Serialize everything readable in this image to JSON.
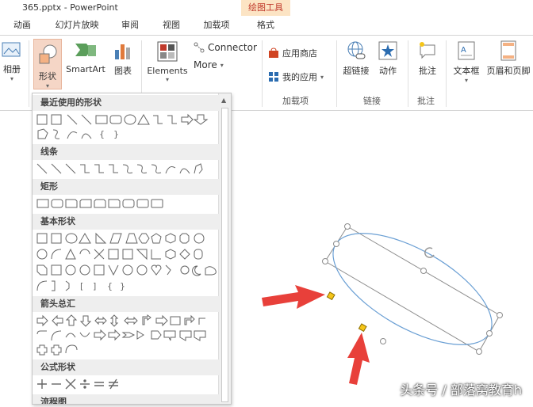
{
  "window": {
    "title": "365.pptx - PowerPoint",
    "context_tab_label": "绘图工具"
  },
  "tabs": [
    {
      "label": "动画"
    },
    {
      "label": "幻灯片放映"
    },
    {
      "label": "审阅"
    },
    {
      "label": "视图"
    },
    {
      "label": "加载项"
    },
    {
      "label": "格式"
    }
  ],
  "ribbon": {
    "album_label": "相册",
    "shapes_label": "形状",
    "smartart_label": "SmartArt",
    "chart_label": "图表",
    "elements_label": "Elements",
    "connector_label": "Connector",
    "more_label": "More",
    "store_label": "应用商店",
    "myapps_label": "我的应用",
    "addins_group": "加载项",
    "hyperlink_label": "超链接",
    "action_label": "动作",
    "links_group": "链接",
    "comment_label": "批注",
    "comments_group": "批注",
    "textbox_label": "文本框",
    "headerfooter_label": "页眉和页脚"
  },
  "shapes_menu": {
    "sections": [
      {
        "title": "最近使用的形状"
      },
      {
        "title": "线条"
      },
      {
        "title": "矩形"
      },
      {
        "title": "基本形状"
      },
      {
        "title": "箭头总汇"
      },
      {
        "title": "公式形状"
      },
      {
        "title": "流程图"
      }
    ]
  },
  "watermark": "头条号 / 部落窝教育h",
  "colors": {
    "ellipse_stroke": "#6a9fd4",
    "arrow": "#e8403a",
    "handle_yellow": "#f5c518",
    "pressed_btn": "#f5d6c6"
  }
}
